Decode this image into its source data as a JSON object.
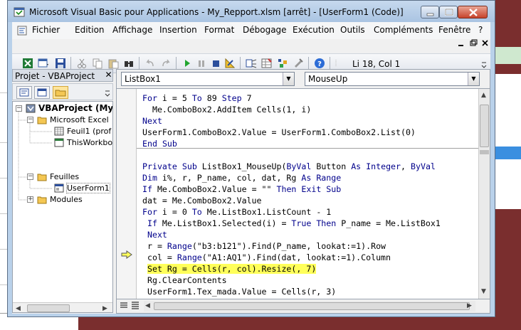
{
  "window": {
    "title": "Microsoft Visual Basic pour Applications - My_Repport.xlsm [arrêt] - [UserForm1 (Code)]"
  },
  "menu": {
    "items": [
      "Fichier",
      "Edition",
      "Affichage",
      "Insertion",
      "Format",
      "Débogage",
      "Exécution",
      "Outils",
      "Compléments",
      "Fenêtre",
      "?"
    ]
  },
  "toolbar": {
    "position": "Li 18, Col 1"
  },
  "project": {
    "title": "Projet - VBAProject",
    "close": "✕",
    "tree": {
      "root": "VBAProject (My_",
      "excel_objects": "Microsoft Excel",
      "sheet1": "Feuil1 (prof",
      "thisworkbook": "ThisWorkbo",
      "forms": "Feuilles",
      "userform": "UserForm1",
      "modules": "Modules"
    }
  },
  "code": {
    "object": "ListBox1",
    "procedure": "MouseUp",
    "lines": [
      "For i = 5 To 89 Step 7",
      "  Me.ComboBox2.AddItem Cells(1, i)",
      "Next",
      "UserForm1.ComboBox2.Value = UserForm1.ComboBox2.List(0)",
      "End Sub",
      "",
      "Private Sub ListBox1_MouseUp(ByVal Button As Integer, ByVal",
      "Dim i%, r, P_name, col, dat, Rg As Range",
      "If Me.ComboBox2.Value = \"\" Then Exit Sub",
      "dat = Me.ComboBox2.Value",
      "For i = 0 To Me.ListBox1.ListCount - 1",
      " If Me.ListBox1.Selected(i) = True Then P_name = Me.ListBox1",
      " Next",
      " r = Range(\"b3:b121\").Find(P_name, lookat:=1).Row",
      " col = Range(\"A1:AQ1\").Find(dat, lookat:=1).Column",
      " Set Rg = Cells(r, col).Resize(, 7)",
      " Rg.ClearContents",
      " UserForm1.Tex_mada.Value = Cells(r, 3)"
    ],
    "highlight_line": 15,
    "colors": {
      "highlight": "#ffff5a",
      "keyword": "#00008b"
    }
  }
}
